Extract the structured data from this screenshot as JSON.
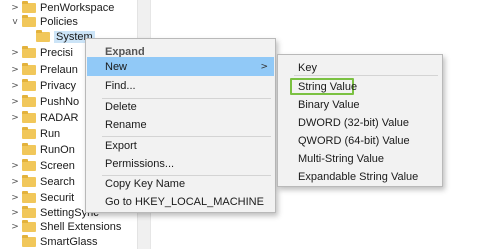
{
  "tree": {
    "items": [
      {
        "label": "PenWorkspace",
        "chevron": ">"
      },
      {
        "label": "Policies",
        "chevron": "v"
      },
      {
        "label": "System",
        "chevron": ""
      },
      {
        "label": "Precisi",
        "chevron": ">"
      },
      {
        "label": "Prelaun",
        "chevron": ">"
      },
      {
        "label": "Privacy",
        "chevron": ">"
      },
      {
        "label": "PushNo",
        "chevron": ">"
      },
      {
        "label": "RADAR",
        "chevron": ">"
      },
      {
        "label": "Run",
        "chevron": ""
      },
      {
        "label": "RunOn",
        "chevron": ""
      },
      {
        "label": "Screen",
        "chevron": ">"
      },
      {
        "label": "Search",
        "chevron": ">"
      },
      {
        "label": "Securit",
        "chevron": ">"
      },
      {
        "label": "SettingSync",
        "chevron": ">"
      },
      {
        "label": "Shell Extensions",
        "chevron": ">"
      },
      {
        "label": "SmartGlass",
        "chevron": ""
      }
    ]
  },
  "context_menu": {
    "header": "Expand",
    "new": "New",
    "new_arrow": ">",
    "find": "Find...",
    "delete": "Delete",
    "rename": "Rename",
    "export": "Export",
    "permissions": "Permissions...",
    "copy_key_name": "Copy Key Name",
    "goto": "Go to HKEY_LOCAL_MACHINE"
  },
  "submenu": {
    "key": "Key",
    "string_value": "String Value",
    "binary_value": "Binary Value",
    "dword_value": "DWORD (32-bit) Value",
    "qword_value": "QWORD (64-bit) Value",
    "multi_string_value": "Multi-String Value",
    "expandable_string_value": "Expandable String Value"
  },
  "colors": {
    "hover": "#91c9f7",
    "highlight_outline": "#7bc142",
    "folder": "#f1c75a"
  }
}
